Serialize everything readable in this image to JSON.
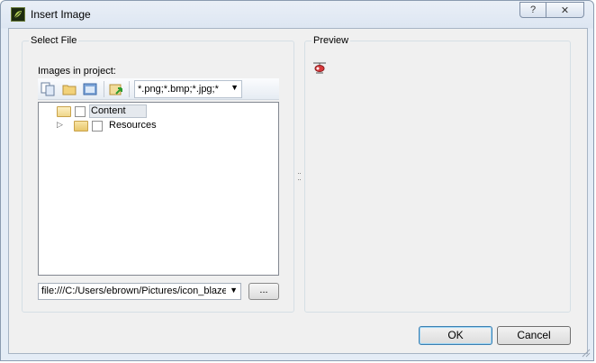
{
  "window": {
    "title": "Insert Image",
    "help_glyph": "?",
    "close_glyph": "✕"
  },
  "select_file": {
    "group_title": "Select File",
    "images_label": "Images in project:",
    "filter_value": "*.png;*.bmp;*.jpg;*",
    "toolbar_icons": [
      "copy-icon",
      "folder-icon",
      "view-icon",
      "import-image-icon"
    ],
    "tree": [
      {
        "label": "Content",
        "expanded": true,
        "selected": true
      },
      {
        "label": "Resources",
        "expanded": false,
        "selected": false
      }
    ],
    "path_value": "file:///C:/Users/ebrown/Pictures/icon_blaze",
    "browse_label": "..."
  },
  "preview": {
    "group_title": "Preview",
    "image_icon": "helicopter-icon"
  },
  "buttons": {
    "ok": "OK",
    "cancel": "Cancel"
  },
  "colors": {
    "accent_border": "#3c7fb1",
    "folder": "#e8c66b"
  }
}
